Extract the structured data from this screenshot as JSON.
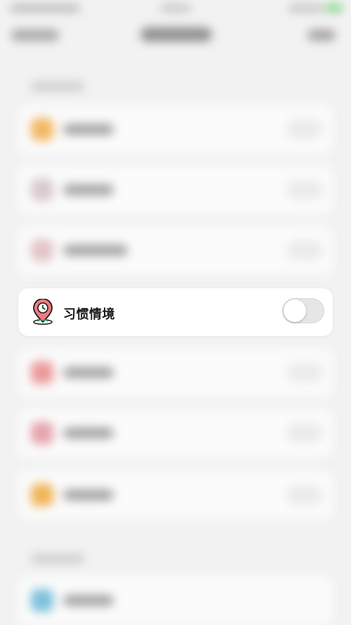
{
  "focused_row": {
    "label": "习惯情境",
    "icon": "location-pin-clock-icon",
    "toggle_on": false
  },
  "colors": {
    "accent": "#e8545a",
    "toggle_off": "#e6e6e6",
    "background": "#f3f3f3"
  }
}
